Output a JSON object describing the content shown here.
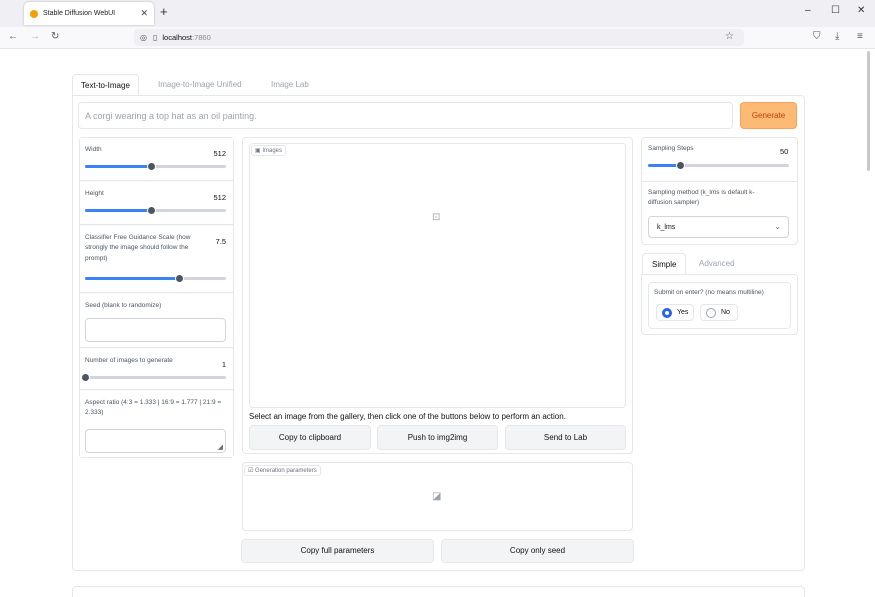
{
  "browser": {
    "tab_title": "Stable Diffusion WebUI",
    "tab_close": "✕",
    "new_tab": "+",
    "url_host": "localhost",
    "url_port": ":7860",
    "icons": [
      "back-icon",
      "forward-icon",
      "reload-icon",
      "shield-icon",
      "page-icon",
      "star-icon",
      "pocket-icon",
      "download-icon",
      "menu-icon"
    ]
  },
  "window_controls": {
    "minimize": "–",
    "maximize": "☐",
    "close": "✕"
  },
  "tabs": [
    "Text-to-Image",
    "Image-to-Image Unified",
    "Image Lab"
  ],
  "prompt": {
    "placeholder": "A corgi wearing a top hat as an oil painting."
  },
  "generate_label": "Generate",
  "left_panel": {
    "width": {
      "label": "Width",
      "value": "512",
      "fraction": 0.47
    },
    "height": {
      "label": "Height",
      "value": "512",
      "fraction": 0.47
    },
    "cfg": {
      "label": "Classifier Free Guidance Scale (how strongly the image should follow the prompt)",
      "value": "7.5",
      "fraction": 0.67
    },
    "seed": {
      "label": "Seed (blank to randomize)"
    },
    "num_images": {
      "label": "Number of images to generate",
      "value": "1",
      "fraction": 0.0
    },
    "aspect": {
      "label": "Aspect ratio (4:3 = 1.333 | 16:9 = 1.777 | 21:9 = 2.333)"
    }
  },
  "gallery": {
    "label": "Images",
    "hint": "Select an image from the gallery, then click one of the buttons below to perform an action.",
    "buttons": [
      "Copy to clipboard",
      "Push to img2img",
      "Send to Lab"
    ]
  },
  "params": {
    "label": "Generation parameters",
    "buttons": [
      "Copy full parameters",
      "Copy only seed"
    ]
  },
  "right_panel": {
    "steps": {
      "label": "Sampling Steps",
      "value": "50",
      "fraction": 0.23
    },
    "sampler": {
      "label": "Sampling method (k_lms is default k-diffusion sampler)",
      "value": "k_lms"
    },
    "tabs": [
      "Simple",
      "Advanced"
    ],
    "submit": {
      "label": "Submit on enter? (no means multiline)",
      "options": [
        "Yes",
        "No"
      ],
      "selected": "Yes"
    }
  },
  "colors": {
    "accent": "#3b82f6",
    "generate_bg": "#fdba74",
    "generate_text": "#c2410c"
  }
}
